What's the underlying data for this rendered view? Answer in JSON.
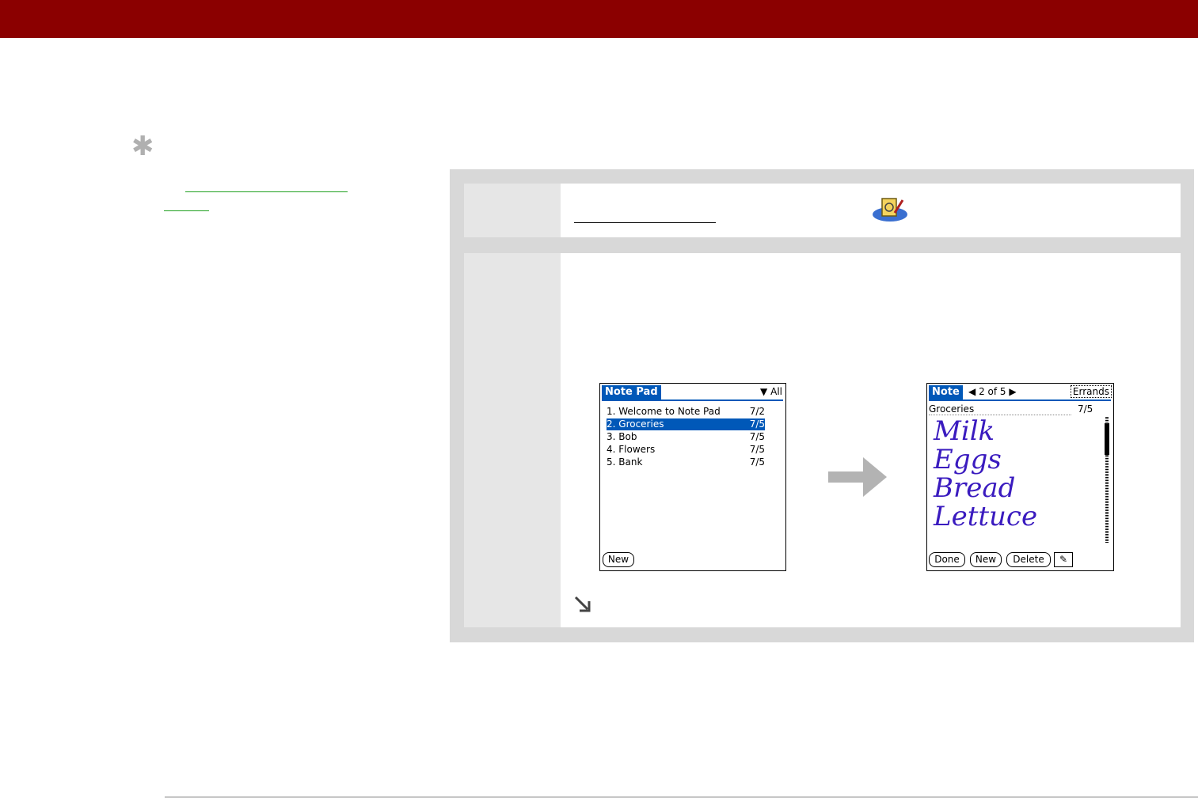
{
  "brand_color": "#8b0000",
  "link_color": "#1fa01f",
  "sidebar": {
    "tip_icon": "asterisk-icon"
  },
  "step1": {
    "app_icon": "note-pad-app-icon"
  },
  "step2": {
    "list_screen": {
      "title": "Note Pad",
      "category": "All",
      "items": [
        {
          "label": "1.  Welcome to Note Pad",
          "date": "7/2",
          "selected": false
        },
        {
          "label": "2.  Groceries",
          "date": "7/5",
          "selected": true
        },
        {
          "label": "3.  Bob",
          "date": "7/5",
          "selected": false
        },
        {
          "label": "4.  Flowers",
          "date": "7/5",
          "selected": false
        },
        {
          "label": "5.  Bank",
          "date": "7/5",
          "selected": false
        }
      ],
      "new_button": "New"
    },
    "note_screen": {
      "title": "Note",
      "counter": "2 of 5",
      "category": "Errands",
      "note_title": "Groceries",
      "note_date": "7/5",
      "handwriting": [
        "Milk",
        "Eggs",
        "Bread",
        "Lettuce"
      ],
      "buttons": {
        "done": "Done",
        "new": "New",
        "delete": "Delete"
      }
    },
    "transition_icon": "right-arrow-icon",
    "continue_icon": "down-right-arrow-icon"
  }
}
